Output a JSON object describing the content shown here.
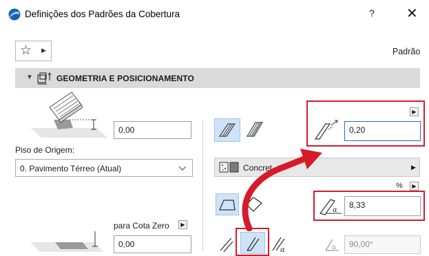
{
  "window": {
    "title": "Definições dos Padrões da Cobertura",
    "help_label": "?",
    "close_label": "✕"
  },
  "toolbar": {
    "favorites_icon": "star-icon",
    "preset_label": "Padrão"
  },
  "panel": {
    "title": "GEOMETRIA E POSICIONAMENTO"
  },
  "left": {
    "height_value": "0,00",
    "home_story_label": "Piso de Origem:",
    "home_story_value": "0. Pavimento Térreo (Atual)",
    "zero_level_label": "para Cota Zero",
    "zero_value": "0,00"
  },
  "right": {
    "thickness_value": "0,20",
    "material_label": "Concret",
    "percent_label": "%",
    "slope_value": "8,33",
    "angle_value": "90,00°"
  },
  "colors": {
    "highlight_red": "#d51a2a",
    "selected_blue": "#cfe3f7",
    "focus_blue": "#1e6bd6"
  }
}
